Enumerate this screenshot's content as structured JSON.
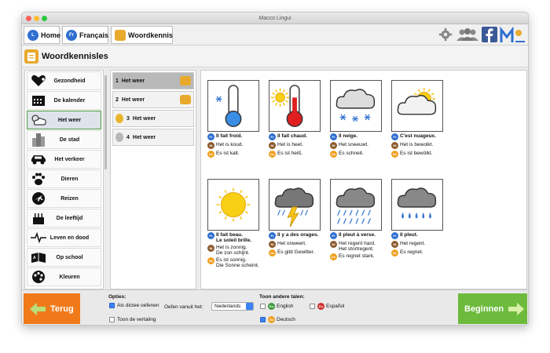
{
  "window": {
    "title": "Macco Lingui"
  },
  "nav": {
    "home": "Home",
    "francais": "Français",
    "woordkennis": "Woordkennis",
    "home_badge": "L",
    "fr_badge": "Fr"
  },
  "page": {
    "title": "Woordkennisles"
  },
  "categories": [
    {
      "label": "Gezondheid",
      "icon": "heart-icon"
    },
    {
      "label": "De kalender",
      "icon": "calendar-icon"
    },
    {
      "label": "Het weer",
      "icon": "weather-icon",
      "active": true
    },
    {
      "label": "De stad",
      "icon": "city-icon"
    },
    {
      "label": "Het verkeer",
      "icon": "car-icon"
    },
    {
      "label": "Dieren",
      "icon": "paw-icon"
    },
    {
      "label": "Reizen",
      "icon": "plane-icon"
    },
    {
      "label": "De leeftijd",
      "icon": "cake-icon"
    },
    {
      "label": "Leven en dood",
      "icon": "heartbeat-icon"
    },
    {
      "label": "Op school",
      "icon": "school-icon"
    },
    {
      "label": "Kleuren",
      "icon": "palette-icon"
    }
  ],
  "lessons": [
    {
      "num": "1",
      "label": "Het weer",
      "active": true
    },
    {
      "num": "2",
      "label": "Het weer"
    },
    {
      "num": "3",
      "label": "Het weer"
    },
    {
      "num": "4",
      "label": "Het weer"
    }
  ],
  "lang": {
    "fr": "Fr",
    "nl": "Nl",
    "de": "De",
    "en": "En",
    "es": "Es"
  },
  "cards": [
    {
      "icon": "cold-thermometer-icon",
      "fr": "Il fait froid.",
      "nl": "Het is koud.",
      "de": "Es ist kalt."
    },
    {
      "icon": "hot-thermometer-icon",
      "fr": "Il fait chaud.",
      "nl": "Het is heet.",
      "de": "Es ist heiß."
    },
    {
      "icon": "snow-cloud-icon",
      "fr": "Il neige.",
      "nl": "Het sneeuwt.",
      "de": "Es schneit."
    },
    {
      "icon": "sun-cloud-icon",
      "fr": "C'est nuageux.",
      "nl": "Het is bewolkt.",
      "de": "Es ist bewölkt."
    },
    {
      "icon": "sun-icon",
      "fr": "Il fait beau.\nLe soleil brille.",
      "nl": "Het is zonnig.\nDe zon schijnt.",
      "de": "Es ist sonnig.\nDie Sonne scheint."
    },
    {
      "icon": "thunder-cloud-icon",
      "fr": "Il y a des orages.",
      "nl": "Het onweert.",
      "de": "Es gibt Gewitter."
    },
    {
      "icon": "heavy-rain-cloud-icon",
      "fr": "Il pleut à verse.",
      "nl": "Het regent hard.\nHet stortregent.",
      "de": "Es regnet stark."
    },
    {
      "icon": "rain-cloud-icon",
      "fr": "Il pleut.",
      "nl": "Het regent.",
      "de": "Es regnet."
    }
  ],
  "bottom": {
    "back": "Terug",
    "options": "Opties:",
    "dictee": "Als dictee oefenen",
    "oefen": "Oefen vanuit het:",
    "oefen_value": "Nederlands",
    "vertaling": "Toon de vertaling",
    "toon_talen": "Toon andere talen:",
    "english": "English",
    "espanol": "Español",
    "deutsch": "Deutsch",
    "start": "Beginnen"
  },
  "colors": {
    "fr": "#2f6fd0",
    "nl": "#8b5a2b",
    "de": "#f0a020",
    "en": "#3c9a3c",
    "es": "#d03030",
    "back": "#f07a1a",
    "start": "#6cbb3c"
  }
}
